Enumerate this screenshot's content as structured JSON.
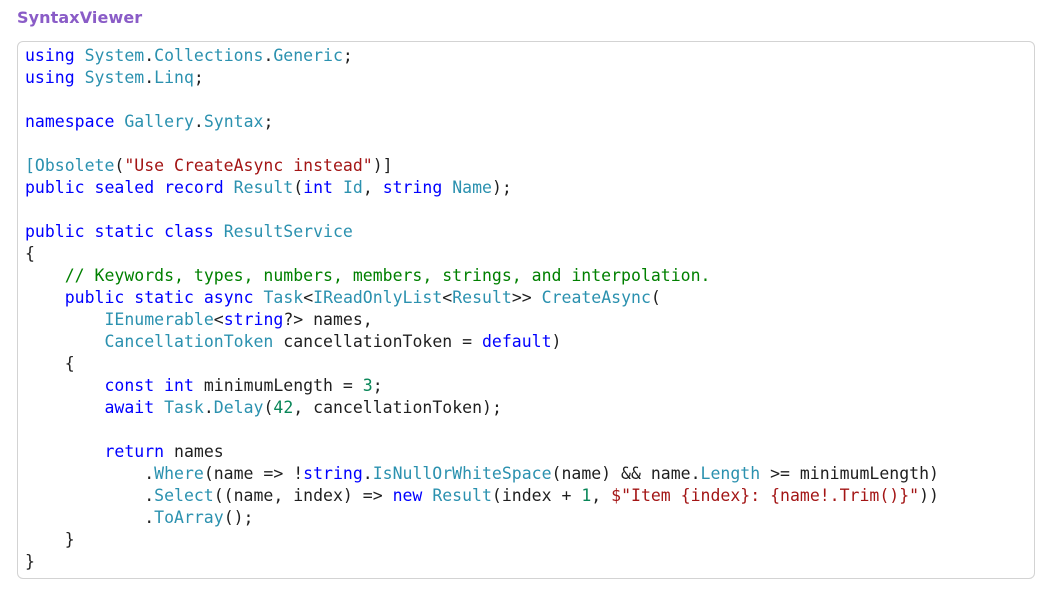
{
  "app": {
    "title": "SyntaxViewer"
  },
  "colors": {
    "title": "#8a5cc7",
    "keyword": "#0000ff",
    "type": "#2b91af",
    "string": "#a31515",
    "comment": "#008000",
    "number": "#098658",
    "plain": "#1f1f1f",
    "panel_border": "#d3d3d3"
  },
  "code": {
    "language": "csharp",
    "lines": [
      [
        [
          "kw",
          "using"
        ],
        [
          "p",
          " "
        ],
        [
          "type",
          "System"
        ],
        [
          "p",
          "."
        ],
        [
          "type",
          "Collections"
        ],
        [
          "p",
          "."
        ],
        [
          "type",
          "Generic"
        ],
        [
          "p",
          ";"
        ]
      ],
      [
        [
          "kw",
          "using"
        ],
        [
          "p",
          " "
        ],
        [
          "type",
          "System"
        ],
        [
          "p",
          "."
        ],
        [
          "type",
          "Linq"
        ],
        [
          "p",
          ";"
        ]
      ],
      [],
      [
        [
          "kw",
          "namespace"
        ],
        [
          "p",
          " "
        ],
        [
          "type",
          "Gallery"
        ],
        [
          "p",
          "."
        ],
        [
          "type",
          "Syntax"
        ],
        [
          "p",
          ";"
        ]
      ],
      [],
      [
        [
          "type",
          "[Obsolete"
        ],
        [
          "p",
          "("
        ],
        [
          "str",
          "\"Use CreateAsync instead\""
        ],
        [
          "p",
          ")]"
        ]
      ],
      [
        [
          "kw",
          "public"
        ],
        [
          "p",
          " "
        ],
        [
          "kw",
          "sealed"
        ],
        [
          "p",
          " "
        ],
        [
          "kw",
          "record"
        ],
        [
          "p",
          " "
        ],
        [
          "type",
          "Result"
        ],
        [
          "p",
          "("
        ],
        [
          "kw",
          "int"
        ],
        [
          "p",
          " "
        ],
        [
          "type",
          "Id"
        ],
        [
          "p",
          ", "
        ],
        [
          "kw",
          "string"
        ],
        [
          "p",
          " "
        ],
        [
          "type",
          "Name"
        ],
        [
          "p",
          ");"
        ]
      ],
      [],
      [
        [
          "kw",
          "public"
        ],
        [
          "p",
          " "
        ],
        [
          "kw",
          "static"
        ],
        [
          "p",
          " "
        ],
        [
          "kw",
          "class"
        ],
        [
          "p",
          " "
        ],
        [
          "type",
          "ResultService"
        ]
      ],
      [
        [
          "p",
          "{"
        ]
      ],
      [
        [
          "p",
          "    "
        ],
        [
          "com",
          "// Keywords, types, numbers, members, strings, and interpolation."
        ]
      ],
      [
        [
          "p",
          "    "
        ],
        [
          "kw",
          "public"
        ],
        [
          "p",
          " "
        ],
        [
          "kw",
          "static"
        ],
        [
          "p",
          " "
        ],
        [
          "kw",
          "async"
        ],
        [
          "p",
          " "
        ],
        [
          "type",
          "Task"
        ],
        [
          "p",
          "<"
        ],
        [
          "type",
          "IReadOnlyList"
        ],
        [
          "p",
          "<"
        ],
        [
          "type",
          "Result"
        ],
        [
          "p",
          ">> "
        ],
        [
          "type",
          "CreateAsync"
        ],
        [
          "p",
          "("
        ]
      ],
      [
        [
          "p",
          "        "
        ],
        [
          "type",
          "IEnumerable"
        ],
        [
          "p",
          "<"
        ],
        [
          "kw",
          "string"
        ],
        [
          "p",
          "?> names,"
        ]
      ],
      [
        [
          "p",
          "        "
        ],
        [
          "type",
          "CancellationToken"
        ],
        [
          "p",
          " cancellationToken = "
        ],
        [
          "kw",
          "default"
        ],
        [
          "p",
          ")"
        ]
      ],
      [
        [
          "p",
          "    {"
        ]
      ],
      [
        [
          "p",
          "        "
        ],
        [
          "kw",
          "const"
        ],
        [
          "p",
          " "
        ],
        [
          "kw",
          "int"
        ],
        [
          "p",
          " minimumLength = "
        ],
        [
          "num",
          "3"
        ],
        [
          "p",
          ";"
        ]
      ],
      [
        [
          "p",
          "        "
        ],
        [
          "kw",
          "await"
        ],
        [
          "p",
          " "
        ],
        [
          "type",
          "Task"
        ],
        [
          "p",
          "."
        ],
        [
          "type",
          "Delay"
        ],
        [
          "p",
          "("
        ],
        [
          "num",
          "42"
        ],
        [
          "p",
          ", cancellationToken);"
        ]
      ],
      [],
      [
        [
          "p",
          "        "
        ],
        [
          "kw",
          "return"
        ],
        [
          "p",
          " names"
        ]
      ],
      [
        [
          "p",
          "            ."
        ],
        [
          "type",
          "Where"
        ],
        [
          "p",
          "(name => !"
        ],
        [
          "kw",
          "string"
        ],
        [
          "p",
          "."
        ],
        [
          "type",
          "IsNullOrWhiteSpace"
        ],
        [
          "p",
          "(name) && name."
        ],
        [
          "type",
          "Length"
        ],
        [
          "p",
          " >= minimumLength)"
        ]
      ],
      [
        [
          "p",
          "            ."
        ],
        [
          "type",
          "Select"
        ],
        [
          "p",
          "((name, index) => "
        ],
        [
          "kw",
          "new"
        ],
        [
          "p",
          " "
        ],
        [
          "type",
          "Result"
        ],
        [
          "p",
          "(index + "
        ],
        [
          "num",
          "1"
        ],
        [
          "p",
          ", "
        ],
        [
          "str",
          "$\"Item {index}: {name!.Trim()}\""
        ],
        [
          "p",
          "))"
        ]
      ],
      [
        [
          "p",
          "            ."
        ],
        [
          "type",
          "ToArray"
        ],
        [
          "p",
          "();"
        ]
      ],
      [
        [
          "p",
          "    }"
        ]
      ],
      [
        [
          "p",
          "}"
        ]
      ]
    ]
  }
}
